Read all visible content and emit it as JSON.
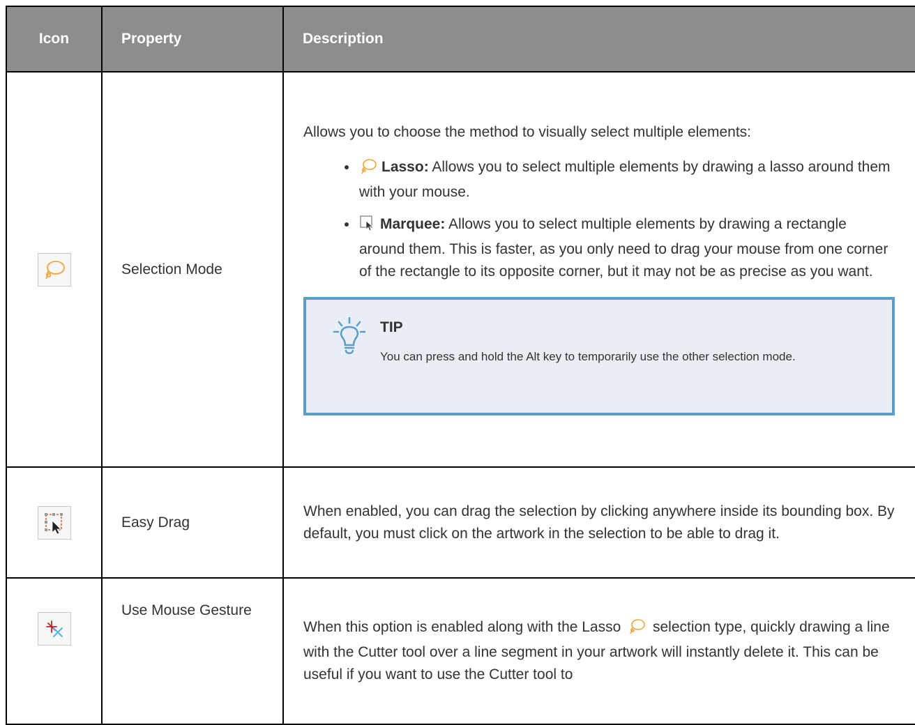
{
  "table": {
    "headers": {
      "icon": "Icon",
      "property": "Property",
      "description": "Description"
    },
    "rows": [
      {
        "icon": "lasso-icon",
        "property": "Selection Mode",
        "intro": "Allows you to choose the method to visually select multiple elements:",
        "options": [
          {
            "icon": "lasso-icon",
            "term": "Lasso:",
            "text": "Allows you to select multiple elements by drawing a lasso around them with your mouse."
          },
          {
            "icon": "marquee-icon",
            "term": "Marquee:",
            "text": "Allows you to select multiple elements by drawing a rectangle around them. This is faster, as you only need to drag your mouse from one corner of the rectangle to its opposite corner, but it may not be as precise as you want."
          }
        ],
        "tip": {
          "icon": "lightbulb-icon",
          "title": "TIP",
          "text": "You can press and hold the Alt key to temporarily use the other selection mode."
        }
      },
      {
        "icon": "easy-drag-icon",
        "property": "Easy Drag",
        "description": "When enabled, you can drag the selection by clicking anywhere inside its bounding box. By default, you must click on the artwork in the selection to be able to drag it."
      },
      {
        "icon": "mouse-gesture-icon",
        "property": "Use Mouse Gesture",
        "description_before": "When this option is enabled along with the Lasso",
        "description_after": "selection type, quickly drawing a line with the Cutter tool over a line segment in your artwork will instantly delete it. This can be useful if you want to use the Cutter tool to"
      }
    ]
  },
  "colors": {
    "header_bg": "#8c8d8f",
    "tip_border": "#5b9ec9",
    "tip_bg": "#e8eef3",
    "lasso_orange": "#f0a43a"
  }
}
